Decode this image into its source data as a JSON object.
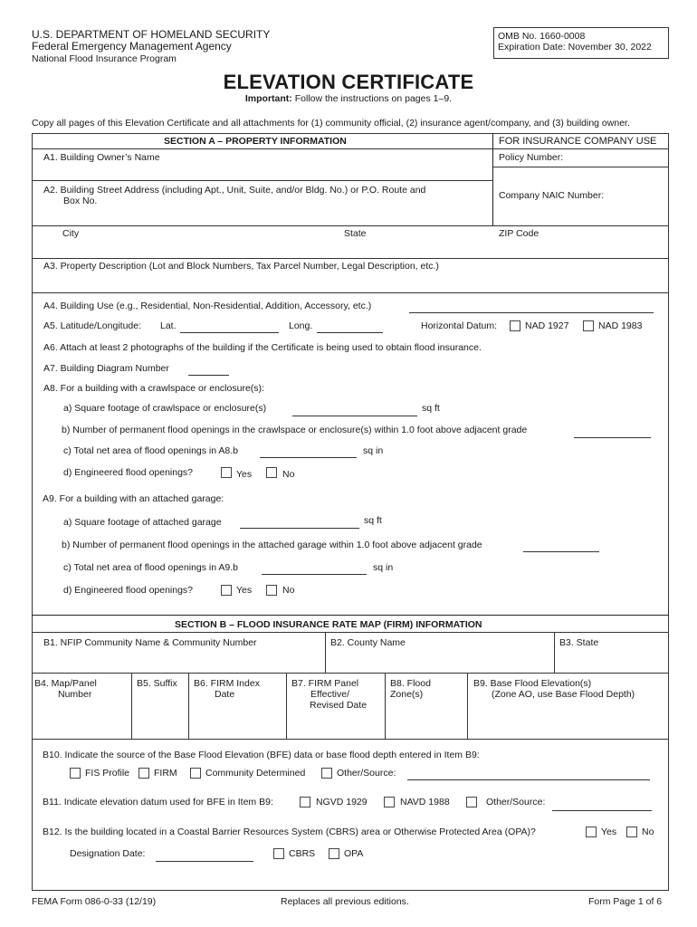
{
  "header": {
    "agency_line1": "U.S. DEPARTMENT OF HOMELAND SECURITY",
    "agency_line2": "Federal Emergency Management Agency",
    "agency_line3": "National Flood Insurance Program",
    "omb_number": "OMB No. 1660-0008",
    "expiration": "Expiration Date: November 30, 2022",
    "title": "ELEVATION CERTIFICATE",
    "important_label": "Important:",
    "important_text": " Follow the instructions on pages 1–9.",
    "copy_instructions": "Copy all pages of this Elevation Certificate and all attachments for (1) community official, (2) insurance agent/company, and (3) building owner."
  },
  "section_a": {
    "title": "SECTION A – PROPERTY INFORMATION",
    "insurance_use": "FOR INSURANCE COMPANY USE",
    "policy_number": "Policy Number:",
    "naic_number": "Company NAIC Number:",
    "a1": "A1.  Building Owner’s Name",
    "a2_line1": "A2.  Building Street Address (including Apt., Unit, Suite, and/or Bldg. No.) or P.O. Route and",
    "a2_line2": "Box No.",
    "city": "City",
    "state": "State",
    "zip": "ZIP Code",
    "a3": "A3.  Property Description (Lot and Block Numbers, Tax Parcel Number, Legal Description, etc.)",
    "a4": "A4.  Building Use (e.g., Residential, Non-Residential, Addition, Accessory, etc.)",
    "a4_value": "",
    "a5": "A5.  Latitude/Longitude:",
    "a5_lat": "Lat.",
    "a5_long": "Long.",
    "a5_lat_value": "",
    "a5_long_value": "",
    "a5_datum": "Horizontal Datum:",
    "a5_nad1927": "NAD 1927",
    "a5_nad1983": "NAD 1983",
    "a6": "A6.  Attach at least 2 photographs of the building if the Certificate is being used to obtain flood insurance.",
    "a7": "A7.  Building Diagram Number",
    "a7_value": "",
    "a8": "A8.  For a building with a crawlspace or enclosure(s):",
    "a8a": "a)  Square footage of crawlspace or enclosure(s)",
    "a8a_unit": "sq ft",
    "a8b": "b)  Number of permanent flood openings in the crawlspace or enclosure(s) within 1.0 foot above adjacent grade",
    "a8c": "c)  Total net area of flood openings in A8.b",
    "a8c_unit": "sq in",
    "a8d": "d)  Engineered flood openings?",
    "yes": "Yes",
    "no": "No",
    "a9": "A9. For a building with an attached garage:",
    "a9a": "a)  Square footage of attached garage",
    "a9a_unit": "sq ft",
    "a9b": "b)  Number of permanent flood openings in the attached garage within 1.0 foot above adjacent grade",
    "a9c": "c)  Total net area of flood openings in A9.b",
    "a9c_unit": "sq in",
    "a9d": "d)  Engineered flood openings?"
  },
  "section_b": {
    "title": "SECTION B – FLOOD INSURANCE RATE MAP (FIRM) INFORMATION",
    "b1": "B1. NFIP Community Name & Community Number",
    "b2": "B2. County Name",
    "b3": "B3.  State",
    "b4_line1": "B4. Map/Panel",
    "b4_line2": "Number",
    "b5": "B5. Suffix",
    "b6_line1": "B6.  FIRM Index",
    "b6_line2": "Date",
    "b7_line1": "B7. FIRM Panel",
    "b7_line2": "Effective/",
    "b7_line3": "Revised Date",
    "b8_line1": "B8. Flood",
    "b8_line2": "Zone(s)",
    "b9_line1": "B9. Base Flood Elevation(s)",
    "b9_line2": "(Zone AO, use Base Flood Depth)",
    "b10": "B10.  Indicate the source of the Base Flood Elevation (BFE) data or base flood depth entered in Item B9:",
    "b10_fis": "FIS Profile",
    "b10_firm": "FIRM",
    "b10_community": "Community Determined",
    "b10_other": "Other/Source:",
    "b11": "B11.  Indicate elevation datum used for BFE in Item B9:",
    "b11_ngvd": "NGVD 1929",
    "b11_navd": "NAVD 1988",
    "b11_other": "Other/Source:",
    "b12": "B12.  Is the building located in a Coastal Barrier Resources System (CBRS) area or Otherwise Protected Area (OPA)?",
    "b12_yes": "Yes",
    "b12_no": "No",
    "b12_designation": "Designation Date:",
    "b12_cbrs": "CBRS",
    "b12_opa": "OPA"
  },
  "footer": {
    "form_number": "FEMA Form 086-0-33 (12/19)",
    "replaces": "Replaces all previous editions.",
    "page": "Form Page 1 of 6"
  }
}
